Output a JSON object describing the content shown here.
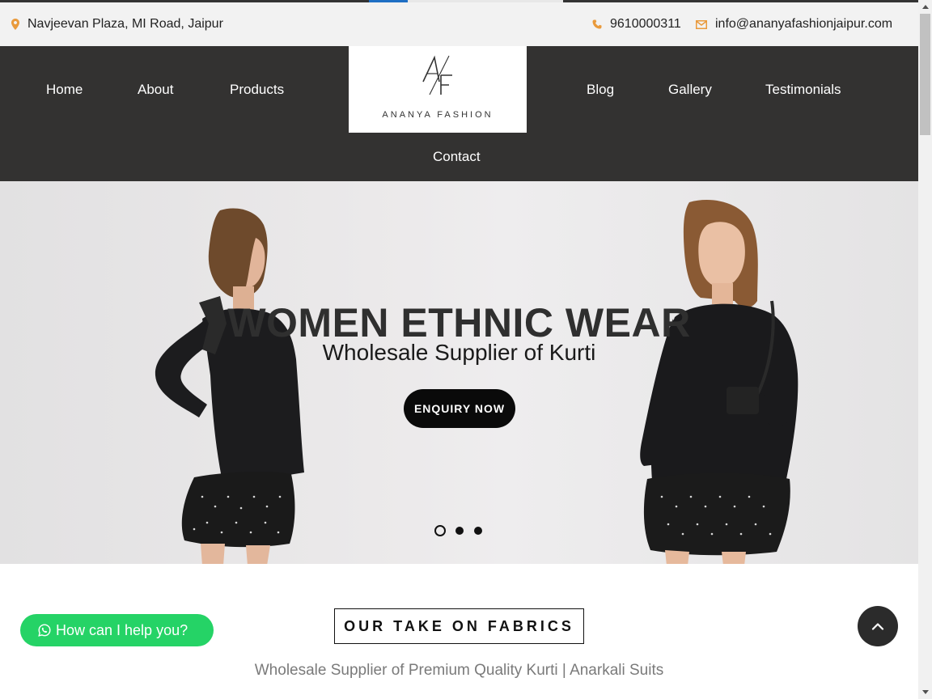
{
  "info_bar": {
    "address": "Navjeevan Plaza, MI Road, Jaipur",
    "phone": "9610000311",
    "email": "info@ananyafashionjaipur.com",
    "icons": {
      "address": "map-marker-icon",
      "phone": "phone-icon",
      "email": "envelope-icon"
    },
    "icon_color": "#e99a3c"
  },
  "nav": {
    "items": [
      {
        "label": "Home"
      },
      {
        "label": "About"
      },
      {
        "label": "Products"
      },
      {
        "label": "Blog"
      },
      {
        "label": "Gallery"
      },
      {
        "label": "Testimonials"
      },
      {
        "label": "Contact"
      }
    ],
    "background": "#333231"
  },
  "logo": {
    "monogram": "A/F",
    "text": "ANANYA FASHION"
  },
  "hero": {
    "title": "WOMEN ETHNIC WEAR",
    "subtitle": "Wholesale Supplier of Kurti",
    "button": "ENQUIRY NOW",
    "slides_total": 3,
    "active_slide": 1
  },
  "fabrics": {
    "heading": "OUR TAKE ON FABRICS",
    "subheading": "Wholesale Supplier of Premium Quality Kurti | Anarkali Suits"
  },
  "whatsapp": {
    "label": "How can I help you?",
    "icon": "whatsapp-icon",
    "color": "#25d366"
  },
  "back_to_top": {
    "icon": "chevron-up-icon"
  }
}
